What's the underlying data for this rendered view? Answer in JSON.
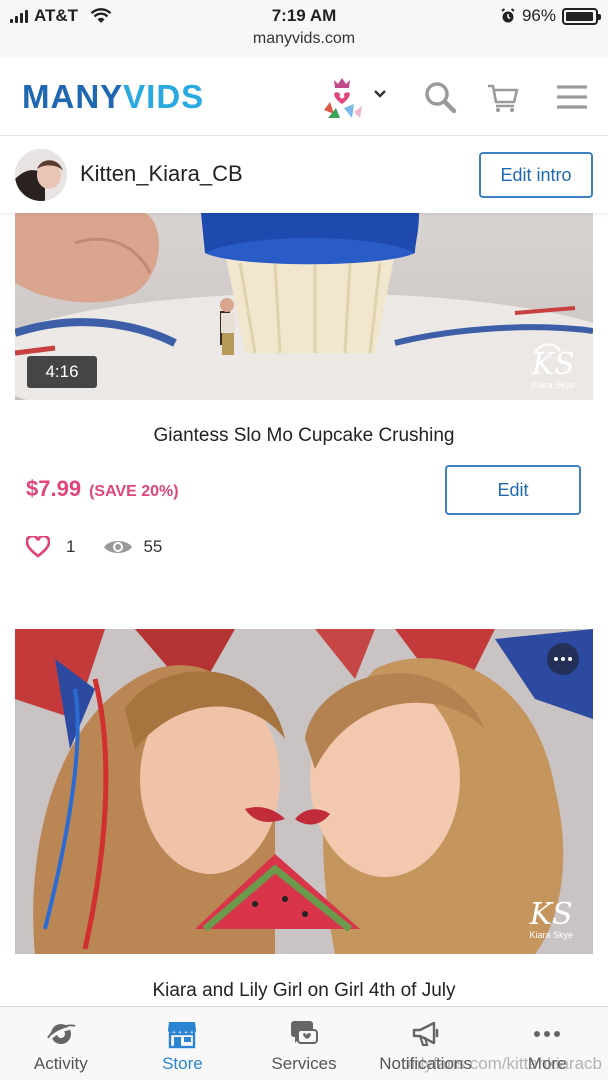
{
  "status_bar": {
    "carrier": "AT&T",
    "time": "7:19 AM",
    "url": "manyvids.com",
    "battery": "96%",
    "battery_level": 0.96
  },
  "header": {
    "logo_part1": "MANY",
    "logo_part2": "VIDS",
    "icons": [
      "flag-heart-icon",
      "chevron-down-icon",
      "search-icon",
      "cart-icon",
      "hamburger-menu-icon"
    ],
    "colors": {
      "logo_dark": "#1f67b1",
      "logo_light": "#2aa8e0"
    }
  },
  "profile": {
    "username": "Kitten_Kiara_CB",
    "edit_intro_label": "Edit intro"
  },
  "videos": [
    {
      "duration": "4:16",
      "watermark": "KS",
      "watermark_name": "Kiara Skye",
      "title": "Giantess Slo Mo Cupcake Crushing",
      "price": "$7.99",
      "save": "(SAVE 20%)",
      "edit_label": "Edit",
      "likes": "1",
      "views": "55"
    },
    {
      "watermark": "KS",
      "watermark_name": "Kiara Skye",
      "title": "Kiara and Lily Girl on Girl 4th of July"
    }
  ],
  "tabs": [
    {
      "label": "Activity",
      "icon": "activity-icon",
      "active": false
    },
    {
      "label": "Store",
      "icon": "store-icon",
      "active": true
    },
    {
      "label": "Services",
      "icon": "services-icon",
      "active": false
    },
    {
      "label": "Notifications",
      "icon": "megaphone-icon",
      "active": false
    },
    {
      "label": "More",
      "icon": "more-dots-icon",
      "active": false
    }
  ],
  "page_watermark": "onlyfans.com/kittenkiaracb",
  "colors": {
    "accent": "#2b84d1",
    "price": "#e0457b"
  }
}
